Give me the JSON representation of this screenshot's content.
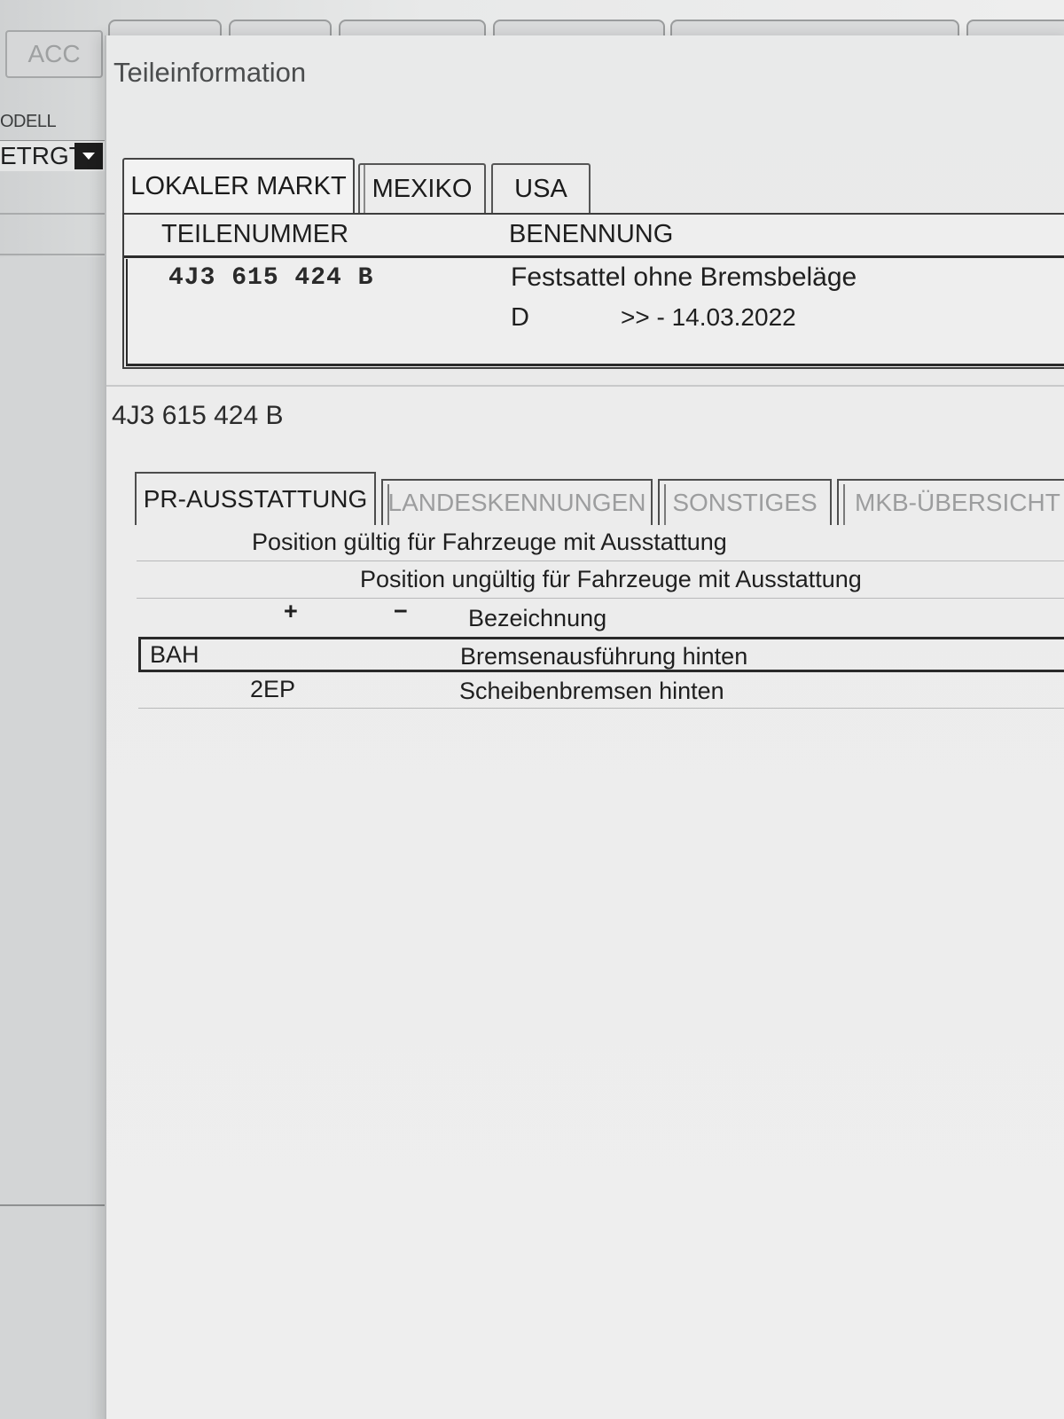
{
  "background_app": {
    "acc_button": "ACC",
    "modell_label": "ODELL",
    "modell_value": "ETRGT"
  },
  "dialog": {
    "title": "Teileinformation",
    "market_tabs": [
      {
        "label": "LOKALER MARKT",
        "active": true
      },
      {
        "label": "MEXIKO",
        "active": false
      },
      {
        "label": "USA",
        "active": false
      }
    ],
    "parts_table": {
      "col_partnumber": "TEILENUMMER",
      "col_name": "BENENNUNG",
      "row": {
        "partnumber": "4J3 615 424 B",
        "name": "Festsattel ohne Bremsbeläge",
        "code": "D",
        "validity": ">> - 14.03.2022"
      }
    }
  },
  "detail": {
    "title": "4J3 615 424 B",
    "tabs": [
      {
        "label": "PR-AUSSTATTUNG",
        "active": true
      },
      {
        "label": "LANDESKENNUNGEN",
        "active": false
      },
      {
        "label": "SONSTIGES",
        "active": false
      },
      {
        "label": "MKB-ÜBERSICHT",
        "active": false
      }
    ],
    "header_valid": "Position gültig für Fahrzeuge mit Ausstattung",
    "header_invalid": "Position ungültig für Fahrzeuge mit Ausstattung",
    "plus": "+",
    "minus": "−",
    "col_bezeichnung": "Bezeichnung",
    "rows": [
      {
        "code": "BAH",
        "description": "Bremsenausführung hinten"
      },
      {
        "code": "2EP",
        "description": "Scheibenbremsen hinten"
      }
    ]
  }
}
